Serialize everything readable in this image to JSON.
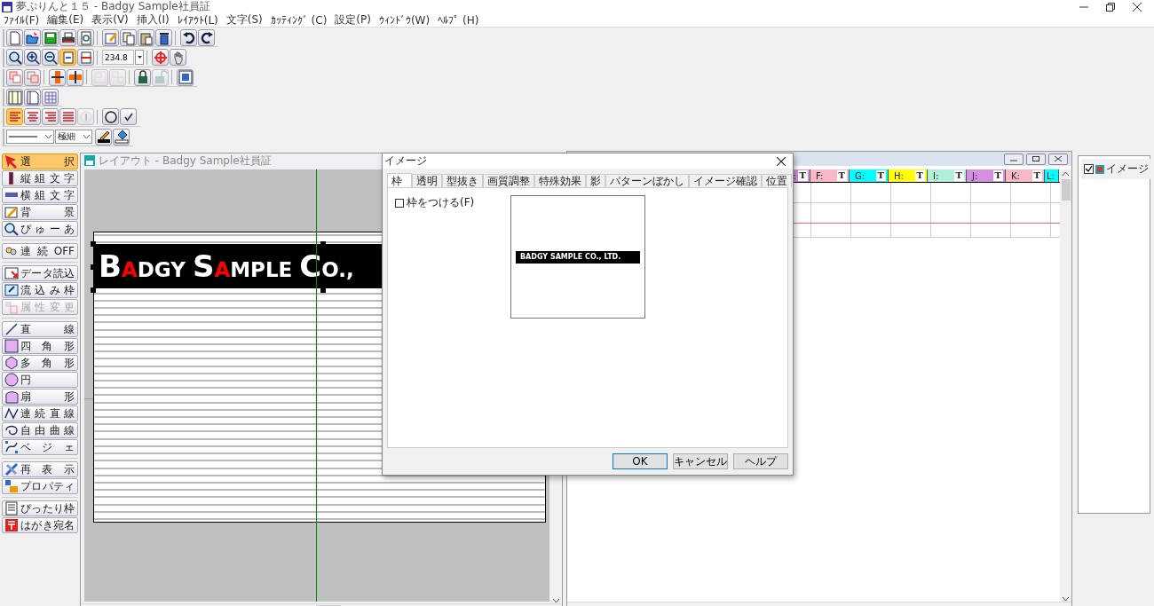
{
  "window": {
    "title": "夢ぷりんと１５ - Badgy Sample社員証"
  },
  "menu": [
    "ﾌｧｲﾙ(F)",
    "編集(E)",
    "表示(V)",
    "挿入(I)",
    "ﾚｲｱｳﾄ(L)",
    "文字(S)",
    "ｶｯﾃｨﾝｸﾞ (C)",
    "設定(P)",
    "ｳｨﾝﾄﾞｳ(W)",
    "ﾍﾙﾌﾟ (H)"
  ],
  "toolbars": [
    {
      "buttons": [
        {
          "selected": false,
          "disabled": false
        },
        {
          "selected": false,
          "disabled": false
        },
        {
          "selected": false,
          "disabled": false
        },
        {
          "selected": false,
          "disabled": false
        },
        {
          "selected": false,
          "disabled": false
        },
        {
          "selected": false,
          "disabled": false
        },
        {
          "selected": false,
          "disabled": false
        },
        {
          "selected": false,
          "disabled": false
        },
        {
          "selected": false,
          "disabled": false
        },
        {
          "selected": false,
          "disabled": false
        },
        {
          "selected": false,
          "disabled": false
        }
      ]
    },
    {
      "buttons": [
        {
          "selected": false,
          "disabled": false
        },
        {
          "selected": false,
          "disabled": false
        },
        {
          "selected": false,
          "disabled": false
        },
        {
          "selected": true,
          "disabled": false
        },
        {
          "selected": false,
          "disabled": false
        },
        {
          "selected": false,
          "disabled": false
        },
        {
          "selected": false,
          "disabled": false
        }
      ],
      "zoom": "234.8"
    },
    {
      "buttons": [
        {
          "selected": false,
          "disabled": false
        },
        {
          "selected": false,
          "disabled": false
        },
        {
          "selected": false,
          "disabled": false
        },
        {
          "selected": false,
          "disabled": false
        },
        {
          "selected": false,
          "disabled": true
        },
        {
          "selected": false,
          "disabled": true
        },
        {
          "selected": false,
          "disabled": false
        },
        {
          "selected": false,
          "disabled": true
        },
        {
          "selected": false,
          "disabled": false
        }
      ]
    },
    {
      "buttons": [
        {
          "selected": false,
          "disabled": false
        },
        {
          "selected": false,
          "disabled": false
        },
        {
          "selected": false,
          "disabled": false
        }
      ]
    },
    {
      "buttons": [
        {
          "selected": true,
          "disabled": false
        },
        {
          "selected": false,
          "disabled": false
        },
        {
          "selected": false,
          "disabled": false
        },
        {
          "selected": false,
          "disabled": false
        },
        {
          "selected": false,
          "disabled": true
        },
        {
          "selected": false,
          "disabled": false
        },
        {
          "disabled": false
        }
      ]
    },
    {
      "buttons": [
        {
          "selected": false,
          "disabled": false
        },
        {
          "selected": false,
          "disabled": false
        }
      ],
      "line_width": "極細"
    }
  ],
  "palette": [
    [
      {
        "label": "選 択",
        "selected": true,
        "disabled": false
      },
      {
        "label": "縦組文字",
        "selected": false,
        "disabled": false
      },
      {
        "label": "横組文字",
        "selected": false,
        "disabled": false
      },
      {
        "label": "背 景",
        "selected": false,
        "disabled": false
      },
      {
        "label": "ぴゅーあ",
        "selected": false,
        "disabled": false
      }
    ],
    [
      {
        "label": "連続OFF",
        "selected": false,
        "disabled": false
      }
    ],
    [
      {
        "label": "データ読込",
        "selected": false,
        "disabled": false
      },
      {
        "label": "流込み枠",
        "selected": false,
        "disabled": false
      },
      {
        "label": "属性変更",
        "selected": false,
        "disabled": true
      }
    ],
    [
      {
        "label": "直 線",
        "selected": false,
        "disabled": false
      },
      {
        "label": "四 角 形",
        "selected": false,
        "disabled": false
      },
      {
        "label": "多 角 形",
        "selected": false,
        "disabled": false
      },
      {
        "label": "円",
        "selected": false,
        "disabled": false
      },
      {
        "label": "扇 形",
        "selected": false,
        "disabled": false
      },
      {
        "label": "連続直線",
        "selected": false,
        "disabled": false
      },
      {
        "label": "自由曲線",
        "selected": false,
        "disabled": false
      },
      {
        "label": "ベ ジ ェ",
        "selected": false,
        "disabled": false
      }
    ],
    [
      {
        "label": "再 表 示",
        "selected": false,
        "disabled": false
      },
      {
        "label": "プロパティ",
        "selected": false,
        "disabled": false
      }
    ],
    [
      {
        "label": "ぴったり枠",
        "selected": false,
        "disabled": false
      },
      {
        "label": "はがき宛名",
        "selected": false,
        "disabled": false
      }
    ]
  ],
  "layout_window": {
    "title": "レイアウト - Badgy Sample社員証",
    "logo": [
      {
        "text": "B",
        "accent": false,
        "initial": true
      },
      {
        "text": "A",
        "accent": true,
        "initial": false
      },
      {
        "text": "DGY ",
        "accent": false,
        "initial": false
      },
      {
        "text": "S",
        "accent": false,
        "initial": true
      },
      {
        "text": "A",
        "accent": true,
        "initial": false
      },
      {
        "text": "MPLE ",
        "accent": false,
        "initial": false
      },
      {
        "text": "C",
        "accent": false,
        "initial": true
      },
      {
        "text": "O.,",
        "accent": false,
        "initial": false
      }
    ]
  },
  "data_window": {
    "columns": [
      {
        "label": ":",
        "color": "#d58ee0",
        "badge": "T"
      },
      {
        "label": "F:",
        "color": "#f8b8c8",
        "badge": "T"
      },
      {
        "label": "G:",
        "color": "#00ffff",
        "badge": "T"
      },
      {
        "label": "H:",
        "color": "#ffff00",
        "badge": "T"
      },
      {
        "label": "I:",
        "color": "#b0f0d8",
        "badge": "T"
      },
      {
        "label": "J:",
        "color": "#d58ee0",
        "badge": "T"
      },
      {
        "label": "K:",
        "color": "#f8b8c8",
        "badge": "T"
      },
      {
        "label": "L:",
        "color": "#00ffff"
      }
    ]
  },
  "object_list": [
    {
      "label": "イメージ",
      "checked": true
    }
  ],
  "dialog": {
    "title": "イメージ",
    "tabs": [
      {
        "label": "枠",
        "selected": true
      },
      {
        "label": "透明",
        "selected": false
      },
      {
        "label": "型抜き",
        "selected": false
      },
      {
        "label": "画質調整",
        "selected": false
      },
      {
        "label": "特殊効果",
        "selected": false
      },
      {
        "label": "影",
        "selected": false
      },
      {
        "label": "パターンぼかし",
        "selected": false
      },
      {
        "label": "イメージ確認",
        "selected": false
      },
      {
        "label": "位置",
        "selected": false
      }
    ],
    "frame_checkbox": {
      "label": "枠をつける(F)",
      "checked": false
    },
    "preview_text": "BADGY SAMPLE CO., LTD.",
    "buttons": [
      {
        "label": "OK",
        "selected": true
      },
      {
        "label": "キャンセル",
        "selected": false
      },
      {
        "label": "ヘルプ",
        "selected": false
      }
    ]
  }
}
